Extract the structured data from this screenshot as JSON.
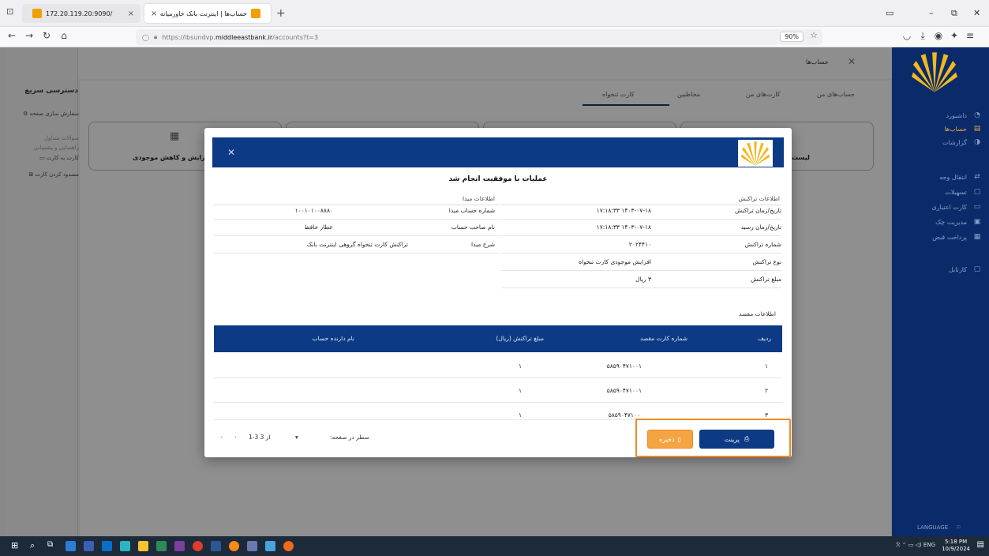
{
  "browser": {
    "tab1_title": "172.20.119.20:9090/",
    "tab2_title": "حساب‌ها | اینترنت بانک خاورمیانه",
    "url_prefix": "https://ibsundvp.",
    "url_domain": "middleeastbank.ir",
    "url_path": "/accounts?t=3",
    "zoom": "90%"
  },
  "header": {
    "title": "حساب‌ها"
  },
  "quick_access": {
    "title": "دسترسی سریع",
    "customize": "سفارش سازی صفحه",
    "items": [
      "سوالات متداول",
      "راهنمایی و پشتیبانی",
      "کارت به کارت",
      "مسدود کردن کارت"
    ]
  },
  "page_tabs": [
    "حساب‌های من",
    "کارت‌های من",
    "مخاطبین",
    "کارت تنخواه"
  ],
  "bg_cards": [
    "افزایش و کاهش موجودی",
    "لیست"
  ],
  "sidebar": {
    "items": [
      {
        "label": "داشبورد",
        "icon": "dashboard-icon"
      },
      {
        "label": "حساب‌ها",
        "icon": "accounts-icon",
        "active": true
      },
      {
        "label": "گزارشات",
        "icon": "reports-icon"
      },
      {
        "label": "انتقال وجه",
        "icon": "transfer-icon"
      },
      {
        "label": "تسهیلات",
        "icon": "loan-icon"
      },
      {
        "label": "کارت اعتباری",
        "icon": "credit-card-icon"
      },
      {
        "label": "مدیریت چک",
        "icon": "cheque-icon"
      },
      {
        "label": "پرداخت قبض",
        "icon": "bill-icon"
      },
      {
        "label": "کارتابل",
        "icon": "cartable-icon"
      }
    ],
    "language": "LANGUAGE"
  },
  "modal": {
    "success": "عملیات با موفقیت انجام شد",
    "tx_info_title": "اطلاعات تراکنش",
    "src_info_title": "اطلاعات مبدا",
    "tx_rows": [
      {
        "label": "تاریخ/زمان تراکنش",
        "value": "۱۴۰۳-۰۷-۱۸ ۱۷:۱۸:۳۳"
      },
      {
        "label": "تاریخ/زمان رسید",
        "value": "۱۴۰۳-۰۷-۱۸ ۱۷:۱۸:۳۳"
      },
      {
        "label": "شماره تراکنش",
        "value": "۲۰۲۴۴۱۰"
      },
      {
        "label": "نوع تراکنش",
        "value": "افزایش موجودی کارت تنخواه"
      },
      {
        "label": "مبلغ تراکنش",
        "value": "۳ ریال"
      }
    ],
    "src_rows": [
      {
        "label": "شماره حساب مبدا",
        "value": "۱۰۰۱۰۱۰۰۸۸۸۰"
      },
      {
        "label": "نام صاحب حساب",
        "value": "عطار حافظ"
      },
      {
        "label": "شرح مبدا",
        "value": "تراکنش کارت تنخواه گروهی اینترنت بانک"
      }
    ],
    "dest_title": "اطلاعات مقصد",
    "dest_columns": [
      "ردیف",
      "شماره کارت مقصد",
      "مبلغ تراکنش (ریال)",
      "نام دارنده حساب"
    ],
    "dest_rows": [
      [
        "۱",
        "۵۸۵۹۰۴۷۱۰۰۱",
        "۱",
        ""
      ],
      [
        "۲",
        "۵۸۵۹۰۴۷۱۰۰۱",
        "۱",
        ""
      ],
      [
        "۳",
        "۵۸۵۹۰۴۷۱۰۰",
        "۱",
        ""
      ]
    ],
    "pagination": {
      "rows_per_page": "سطر در صفحه:",
      "range": "1-3 از 3"
    },
    "print_label": "پرینت",
    "save_label": "ذخیره"
  },
  "taskbar": {
    "lang": "ENG",
    "time": "5:18 PM",
    "date": "10/9/2024"
  }
}
